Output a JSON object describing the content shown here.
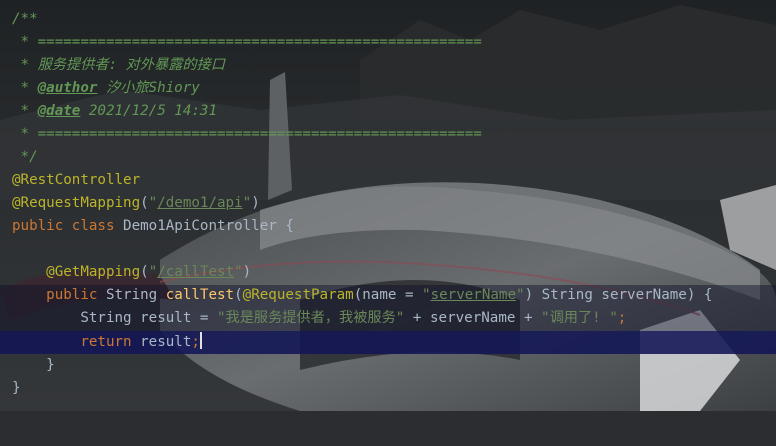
{
  "colors": {
    "background": "#2b2d30",
    "doc_comment": "#629755",
    "annotation": "#bbb529",
    "keyword": "#cc7832",
    "string": "#6a8759",
    "identifier": "#a9b7c6",
    "method": "#ffc66d",
    "current_line": "#121655"
  },
  "code": {
    "l1": "/**",
    "l2": " * ====================================================",
    "l3": " * 服务提供者: 对外暴露的接口",
    "l4_prefix": " * ",
    "l4_tag": "@author",
    "l4_text": " 汐小旅Shiory",
    "l5_prefix": " * ",
    "l5_tag": "@date",
    "l5_text": " 2021/12/5 14:31",
    "l6": " * ====================================================",
    "l7": " */",
    "l8": "@RestController",
    "l9_ann": "@RequestMapping",
    "l9_open": "(",
    "l9_q1": "\"",
    "l9_path": "/demo1/api",
    "l9_q2": "\"",
    "l9_close": ")",
    "l10_kw": "public class ",
    "l10_name": "Demo1ApiController {",
    "l12_indent": "    ",
    "l12_ann": "@GetMapping",
    "l12_open": "(",
    "l12_q1": "\"",
    "l12_path": "/callTest",
    "l12_q2": "\"",
    "l12_close": ")",
    "l13_indent": "    ",
    "l13_kw": "public ",
    "l13_type": "String ",
    "l13_fn": "callTest",
    "l13_open": "(",
    "l13_ann": "@RequestParam",
    "l13_p1": "(",
    "l13_named": "name",
    "l13_eq": " = ",
    "l13_q1": "\"",
    "l13_val": "serverName",
    "l13_q2": "\"",
    "l13_p2": ") String serverName) {",
    "l14_indent": "        ",
    "l14_type": "String result = ",
    "l14_s1": "\"我是服务提供者，我被服务\"",
    "l14_plus1": " + serverName + ",
    "l14_s2": "\"调用了! \"",
    "l14_semi": ";",
    "l15_indent": "        ",
    "l15_kw": "return ",
    "l15_rest": "result",
    "l15_semi": ";",
    "l16": "    }",
    "l17": "}"
  }
}
